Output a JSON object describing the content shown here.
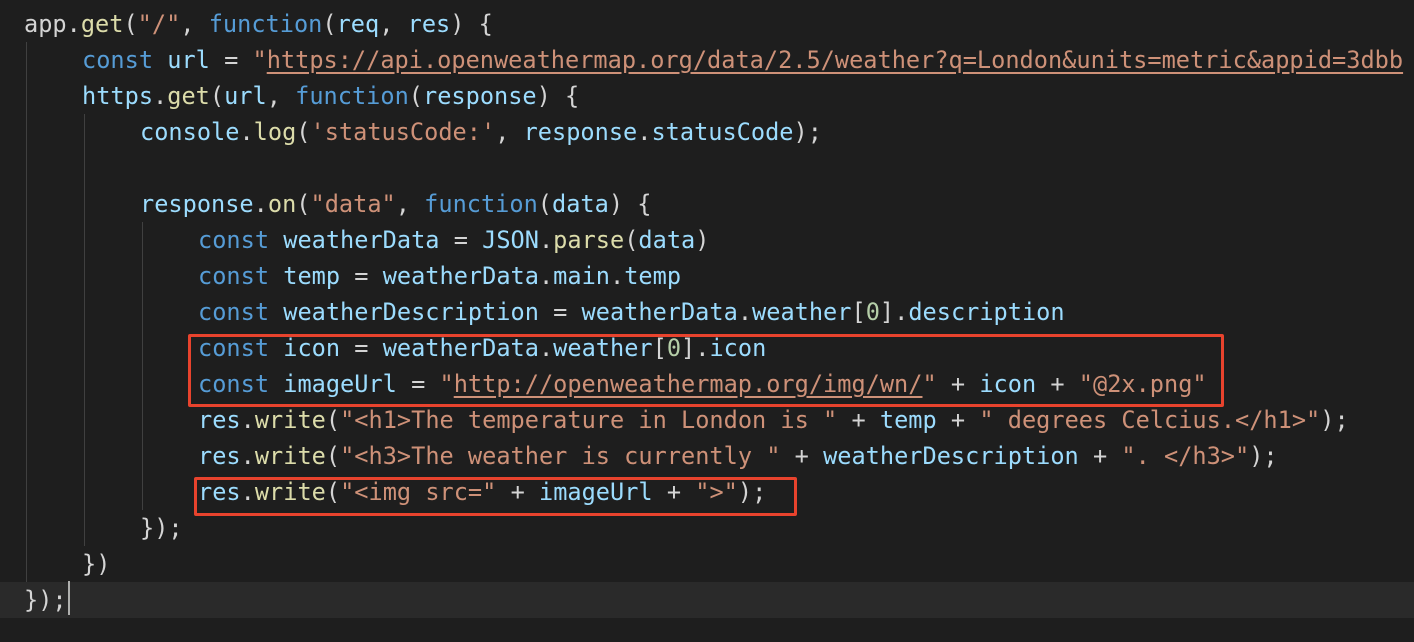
{
  "editor": {
    "language": "javascript",
    "cursor_line": 17,
    "lines": [
      [
        [
          "plain",
          "app."
        ],
        [
          "fn",
          "get"
        ],
        [
          "plain",
          "("
        ],
        [
          "str",
          "\"/\""
        ],
        [
          "plain",
          ", "
        ],
        [
          "kw",
          "function"
        ],
        [
          "plain",
          "("
        ],
        [
          "var",
          "req"
        ],
        [
          "plain",
          ", "
        ],
        [
          "var",
          "res"
        ],
        [
          "plain",
          ") {"
        ]
      ],
      [
        [
          "kw",
          "const "
        ],
        [
          "var",
          "url"
        ],
        [
          "plain",
          " = "
        ],
        [
          "str",
          "\""
        ],
        [
          "url",
          "https://api.openweathermap.org/data/2.5/weather?q=London&units=metric&appid=3dbb"
        ]
      ],
      [
        [
          "var",
          "https"
        ],
        [
          "plain",
          "."
        ],
        [
          "fn",
          "get"
        ],
        [
          "plain",
          "("
        ],
        [
          "var",
          "url"
        ],
        [
          "plain",
          ", "
        ],
        [
          "kw",
          "function"
        ],
        [
          "plain",
          "("
        ],
        [
          "var",
          "response"
        ],
        [
          "plain",
          ") {"
        ]
      ],
      [
        [
          "var",
          "console"
        ],
        [
          "plain",
          "."
        ],
        [
          "fn",
          "log"
        ],
        [
          "plain",
          "("
        ],
        [
          "str",
          "'statusCode:'"
        ],
        [
          "plain",
          ", "
        ],
        [
          "var",
          "response"
        ],
        [
          "plain",
          "."
        ],
        [
          "var",
          "statusCode"
        ],
        [
          "plain",
          ");"
        ]
      ],
      [],
      [
        [
          "var",
          "response"
        ],
        [
          "plain",
          "."
        ],
        [
          "fn",
          "on"
        ],
        [
          "plain",
          "("
        ],
        [
          "str",
          "\"data\""
        ],
        [
          "plain",
          ", "
        ],
        [
          "kw",
          "function"
        ],
        [
          "plain",
          "("
        ],
        [
          "var",
          "data"
        ],
        [
          "plain",
          ") {"
        ]
      ],
      [
        [
          "kw",
          "const "
        ],
        [
          "var",
          "weatherData"
        ],
        [
          "plain",
          " = "
        ],
        [
          "var",
          "JSON"
        ],
        [
          "plain",
          "."
        ],
        [
          "fn",
          "parse"
        ],
        [
          "plain",
          "("
        ],
        [
          "var",
          "data"
        ],
        [
          "plain",
          ")"
        ]
      ],
      [
        [
          "kw",
          "const "
        ],
        [
          "var",
          "temp"
        ],
        [
          "plain",
          " = "
        ],
        [
          "var",
          "weatherData"
        ],
        [
          "plain",
          "."
        ],
        [
          "var",
          "main"
        ],
        [
          "plain",
          "."
        ],
        [
          "var",
          "temp"
        ]
      ],
      [
        [
          "kw",
          "const "
        ],
        [
          "var",
          "weatherDescription"
        ],
        [
          "plain",
          " = "
        ],
        [
          "var",
          "weatherData"
        ],
        [
          "plain",
          "."
        ],
        [
          "var",
          "weather"
        ],
        [
          "plain",
          "["
        ],
        [
          "num",
          "0"
        ],
        [
          "plain",
          "]."
        ],
        [
          "var",
          "description"
        ]
      ],
      [
        [
          "kw",
          "const "
        ],
        [
          "var",
          "icon"
        ],
        [
          "plain",
          " = "
        ],
        [
          "var",
          "weatherData"
        ],
        [
          "plain",
          "."
        ],
        [
          "var",
          "weather"
        ],
        [
          "plain",
          "["
        ],
        [
          "num",
          "0"
        ],
        [
          "plain",
          "]."
        ],
        [
          "var",
          "icon"
        ]
      ],
      [
        [
          "kw",
          "const "
        ],
        [
          "var",
          "imageUrl"
        ],
        [
          "plain",
          " = "
        ],
        [
          "str",
          "\""
        ],
        [
          "url",
          "http://openweathermap.org/img/wn/"
        ],
        [
          "str",
          "\""
        ],
        [
          "plain",
          " + "
        ],
        [
          "var",
          "icon"
        ],
        [
          "plain",
          " + "
        ],
        [
          "str",
          "\"@2x.png\""
        ]
      ],
      [
        [
          "var",
          "res"
        ],
        [
          "plain",
          "."
        ],
        [
          "fn",
          "write"
        ],
        [
          "plain",
          "("
        ],
        [
          "str",
          "\"<h1>The temperature in London is \""
        ],
        [
          "plain",
          " + "
        ],
        [
          "var",
          "temp"
        ],
        [
          "plain",
          " + "
        ],
        [
          "str",
          "\" degrees Celcius.</h1>\""
        ],
        [
          "plain",
          ");"
        ]
      ],
      [
        [
          "var",
          "res"
        ],
        [
          "plain",
          "."
        ],
        [
          "fn",
          "write"
        ],
        [
          "plain",
          "("
        ],
        [
          "str",
          "\"<h3>The weather is currently \""
        ],
        [
          "plain",
          " + "
        ],
        [
          "var",
          "weatherDescription"
        ],
        [
          "plain",
          " + "
        ],
        [
          "str",
          "\". </h3>\""
        ],
        [
          "plain",
          ");"
        ]
      ],
      [
        [
          "var",
          "res"
        ],
        [
          "plain",
          "."
        ],
        [
          "fn",
          "write"
        ],
        [
          "plain",
          "("
        ],
        [
          "str",
          "\"<img src=\""
        ],
        [
          "plain",
          " + "
        ],
        [
          "var",
          "imageUrl"
        ],
        [
          "plain",
          " + "
        ],
        [
          "str",
          "\">\""
        ],
        [
          "plain",
          ");"
        ]
      ],
      [
        [
          "plain",
          "});"
        ]
      ],
      [
        [
          "plain",
          "})"
        ]
      ],
      [
        [
          "plain",
          "});"
        ]
      ]
    ]
  },
  "colors": {
    "background": "#1e1e1e",
    "highlight_box": "#e8432d",
    "keyword": "#569cd6",
    "variable": "#9cdcfe",
    "function": "#dcdcaa",
    "string": "#ce9178",
    "number": "#b5cea8"
  }
}
